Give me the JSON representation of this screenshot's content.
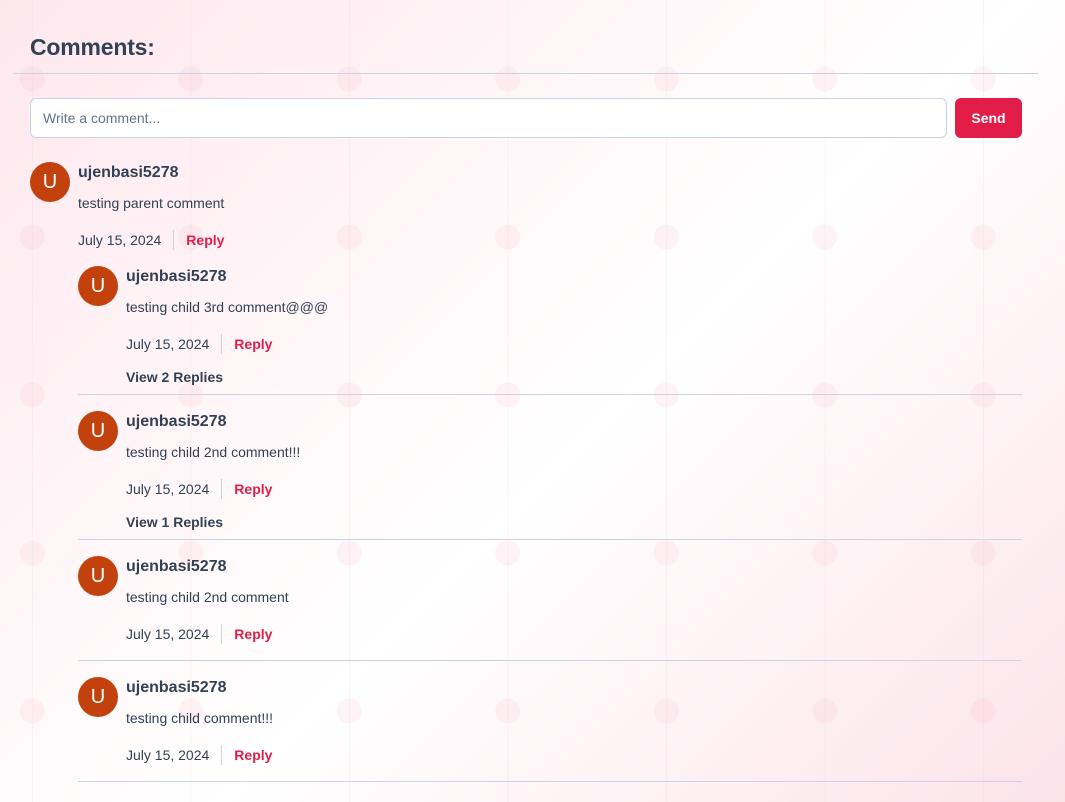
{
  "header": {
    "title": "Comments:"
  },
  "composer": {
    "placeholder": "Write a comment...",
    "value": "",
    "send_label": "Send"
  },
  "parent": {
    "avatar_letter": "U",
    "username": "ujenbasi5278",
    "text": "testing parent comment",
    "date": "July 15, 2024",
    "reply_label": "Reply"
  },
  "children": [
    {
      "avatar_letter": "U",
      "username": "ujenbasi5278",
      "text": "testing child 3rd comment@@@",
      "date": "July 15, 2024",
      "reply_label": "Reply",
      "view_replies": "View 2 Replies"
    },
    {
      "avatar_letter": "U",
      "username": "ujenbasi5278",
      "text": "testing child 2nd comment!!!",
      "date": "July 15, 2024",
      "reply_label": "Reply",
      "view_replies": "View 1 Replies"
    },
    {
      "avatar_letter": "U",
      "username": "ujenbasi5278",
      "text": "testing child 2nd comment",
      "date": "July 15, 2024",
      "reply_label": "Reply"
    },
    {
      "avatar_letter": "U",
      "username": "ujenbasi5278",
      "text": "testing child comment!!!",
      "date": "July 15, 2024",
      "reply_label": "Reply"
    }
  ],
  "colors": {
    "accent": "#e11d48",
    "avatar": "#c2410c",
    "text": "#334155",
    "border": "#cbd5e1"
  }
}
